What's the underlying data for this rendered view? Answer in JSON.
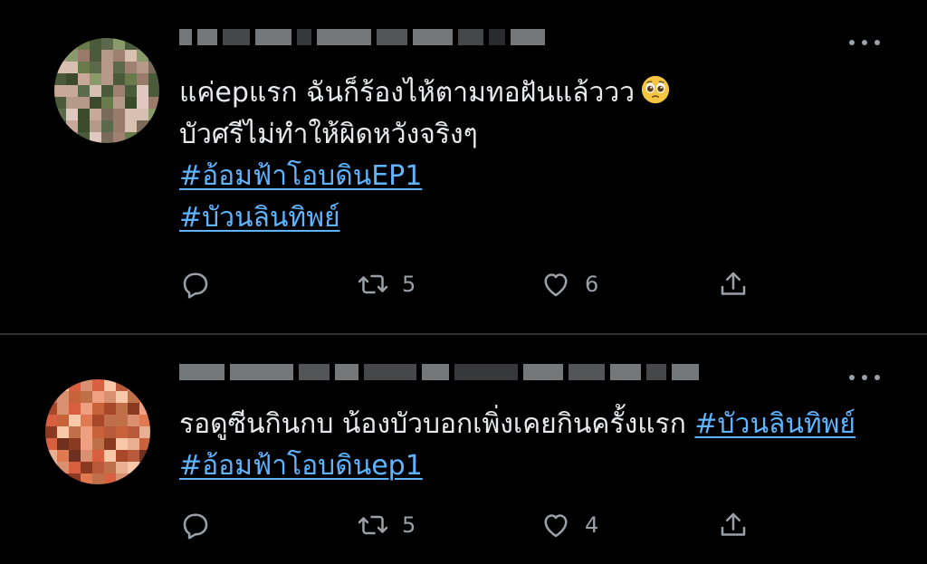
{
  "tweets": [
    {
      "body_line1": "แค่epแรก ฉันก็ร้องไห้ตามทอฝันแล้ววว",
      "body_line2": "บัวศรีไม่ทำให้ผิดหวังจริงๆ",
      "hashtag1": "#อ้อมฟ้าโอบดินEP1",
      "hashtag2": "#บัวนลินทิพย์",
      "emoji": "pleading-face-icon",
      "retweets": "5",
      "likes": "6"
    },
    {
      "body_text": "รอดูซีนกินกบ น้องบัวบอกเพิ่งเคยกินครั้งแรก ",
      "hashtag1": "#บัวนลินทิพย์",
      "hashtag2": "#อ้อมฟ้าโอบดินep1",
      "retweets": "5",
      "likes": "4"
    }
  ],
  "colors": {
    "background": "#000000",
    "text": "#e7e9ea",
    "hashtag": "#5fb4ff",
    "muted": "#9aa0a6",
    "divider": "#2f3336"
  },
  "icons": [
    "reply-icon",
    "retweet-icon",
    "like-icon",
    "share-icon",
    "more-icon"
  ]
}
